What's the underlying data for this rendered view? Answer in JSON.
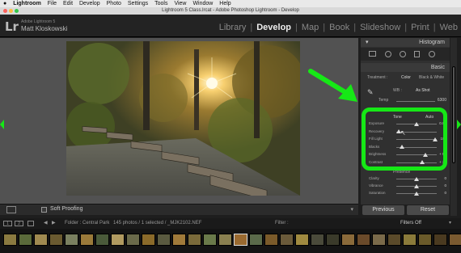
{
  "menubar": {
    "app_name": "Lightroom",
    "items": [
      "File",
      "Edit",
      "Develop",
      "Photo",
      "Settings",
      "Tools",
      "View",
      "Window",
      "Help"
    ]
  },
  "window": {
    "title": "Lightroom 5 Class.lrcat - Adobe Photoshop Lightroom - Develop"
  },
  "identity": {
    "logo": "Lr",
    "catalog_line": "Adobe Lightroom 5",
    "user_name": "Matt Kloskowski"
  },
  "modules": [
    {
      "label": "Library",
      "active": false
    },
    {
      "label": "Develop",
      "active": true
    },
    {
      "label": "Map",
      "active": false
    },
    {
      "label": "Book",
      "active": false
    },
    {
      "label": "Slideshow",
      "active": false
    },
    {
      "label": "Print",
      "active": false
    },
    {
      "label": "Web",
      "active": false
    }
  ],
  "panel": {
    "histogram_label": "Histogram",
    "basic_label": "Basic",
    "treatment_label": "Treatment :",
    "color_label": "Color",
    "bw_label": "Black & White",
    "wb_label": "WB :",
    "wb_value": "As Shot",
    "temp_label": "Temp",
    "temp_value": "6300",
    "tone_label": "Tone",
    "auto_label": "Auto",
    "presence_label": "Presence",
    "sliders": [
      {
        "label": "Exposure",
        "value": "0.00",
        "pos": 0.5
      },
      {
        "label": "Recovery",
        "value": "0",
        "pos": 0.06
      },
      {
        "label": "Fill Light",
        "value": "100",
        "pos": 0.96
      },
      {
        "label": "Blacks",
        "value": "5",
        "pos": 0.14
      },
      {
        "label": "Brightness",
        "value": "+ 50",
        "pos": 0.72
      },
      {
        "label": "Contrast",
        "value": "+ 25",
        "pos": 0.64
      }
    ],
    "presence_sliders": [
      {
        "label": "Clarity",
        "value": "0",
        "pos": 0.5
      },
      {
        "label": "Vibrance",
        "value": "0",
        "pos": 0.5
      },
      {
        "label": "Saturation",
        "value": "0",
        "pos": 0.5
      }
    ]
  },
  "toolbar": {
    "soft_proofing_label": "Soft Proofing"
  },
  "buttons": {
    "previous": "Previous",
    "reset": "Reset"
  },
  "filmbar": {
    "page_1": "1",
    "page_2": "2",
    "source": "Folder : Central Park",
    "count": "145 photos / 1 selected / _MJK2102.NEF",
    "filter_label": "Filter :",
    "filter_value": "Filters Off"
  },
  "colors": {
    "highlight_green": "#16e816",
    "panel_bg": "#303030",
    "canvas_bg": "#525252"
  }
}
